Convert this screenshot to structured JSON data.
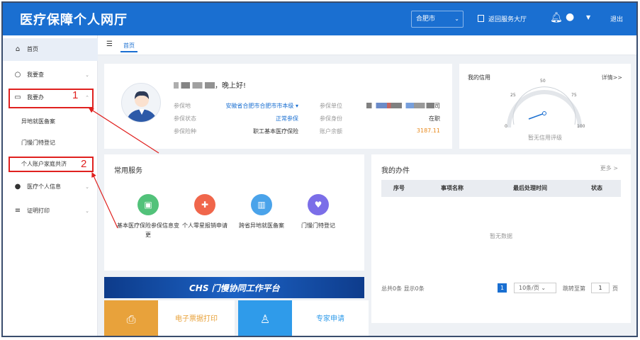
{
  "header": {
    "app_title": "医疗保障个人网厅",
    "city": "合肥市",
    "return_label": "返回服务大厅",
    "logout_label": "退出"
  },
  "sidebar": {
    "home": "首页",
    "query": "我要查",
    "handle": "我要办",
    "sub_items": [
      "异地就医备案",
      "门慢门特登记",
      "个人账户家庭共济"
    ],
    "medical_info": "医疗个人信息",
    "cert_print": "证明打印"
  },
  "annotations": {
    "mark1": "1",
    "mark2": "2"
  },
  "breadcrumb": {
    "tab": "首页"
  },
  "profile": {
    "greeting": "，晚上好!",
    "labels": {
      "insured_place": "参保地",
      "insured_status": "参保状态",
      "insurance_type": "参保险种",
      "employer": "参保单位",
      "identity": "参保身份",
      "balance": "账户余额"
    },
    "values": {
      "insured_place": "安徽省合肥市合肥市市本级",
      "insured_status": "正常参保",
      "insurance_type": "职工基本医疗保险",
      "employer_suffix": "司",
      "identity": "在职",
      "balance": "3187.11"
    }
  },
  "credit": {
    "title": "我的信用",
    "details": "详情>>",
    "gauge_ticks": [
      "0",
      "25",
      "50",
      "75",
      "100"
    ],
    "gauge_value": 0,
    "status": "暂无信用评级"
  },
  "services": {
    "title": "常用服务",
    "items": [
      {
        "label": "基本医疗保险参保信息变更",
        "icon": "id-card-icon",
        "color": "#52c27a"
      },
      {
        "label": "个人零星报销申请",
        "icon": "medkit-icon",
        "color": "#f0664b"
      },
      {
        "label": "跨省异地就医备案",
        "icon": "building-icon",
        "color": "#4aa3ea"
      },
      {
        "label": "门慢门特登记",
        "icon": "heart-icon",
        "color": "#7b6ee8"
      }
    ]
  },
  "my_tasks": {
    "title": "我的办件",
    "more": "更多 >",
    "columns": [
      "序号",
      "事项名称",
      "最后处理时间",
      "状态"
    ],
    "empty": "暂无数据",
    "summary": "总共0条 显示0条",
    "current_page": "1",
    "page_size": "10条/页",
    "jump_label": "跳转至第",
    "jump_value": "1",
    "page_unit": "页"
  },
  "banner": {
    "text": "CHS 门慢协同工作平台"
  },
  "tiles": [
    {
      "label": "电子票据打印",
      "icon": "printer-icon",
      "color": "#e8a23b",
      "text_color": "#e8a23b"
    },
    {
      "label": "专家申请",
      "icon": "person-icon",
      "color": "#2f9bea",
      "text_color": "#2f9bea"
    }
  ]
}
